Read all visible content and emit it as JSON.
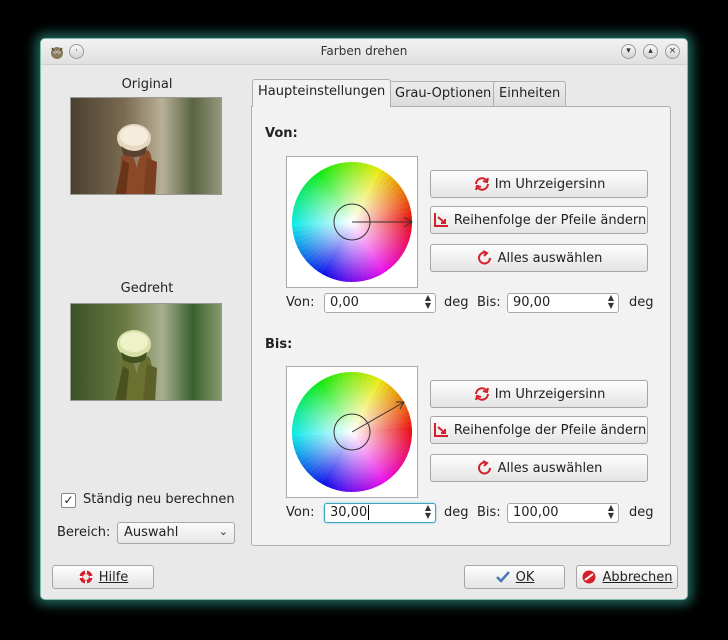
{
  "window": {
    "title": "Farben drehen",
    "app_icon": "gimp-icon",
    "controls": [
      "menu-dot-icon",
      "minimize-icon",
      "maximize-icon",
      "close-icon"
    ]
  },
  "preview": {
    "original_label": "Original",
    "rotated_label": "Gedreht",
    "continuous_label": "Ständig neu berechnen",
    "continuous_checked": true,
    "area_label": "Bereich:",
    "area_value": "Auswahl"
  },
  "tabs": [
    {
      "label": "Haupteinstellungen",
      "active": true
    },
    {
      "label": "Grau-Optionen",
      "active": false
    },
    {
      "label": "Einheiten",
      "active": false
    }
  ],
  "from": {
    "title": "Von:",
    "btn_clockwise": "Im Uhrzeigersinn",
    "btn_swap": "Reihenfolge der Pfeile ändern",
    "btn_select_all": "Alles auswählen",
    "from_label": "Von:",
    "from_value": "0,00",
    "to_label": "Bis:",
    "to_value": "90,00",
    "unit": "deg"
  },
  "to": {
    "title": "Bis:",
    "btn_clockwise": "Im Uhrzeigersinn",
    "btn_swap": "Reihenfolge der Pfeile ändern",
    "btn_select_all": "Alles auswählen",
    "from_label": "Von:",
    "from_value": "30,00",
    "to_label": "Bis:",
    "to_value": "100,00",
    "unit": "deg"
  },
  "footer": {
    "help": "Hilfe",
    "ok": "OK",
    "cancel": "Abbrechen"
  },
  "colors": {
    "accent": "#3fa3bd",
    "glow": "#3cc8b4",
    "icon_red": "#d4202a"
  }
}
